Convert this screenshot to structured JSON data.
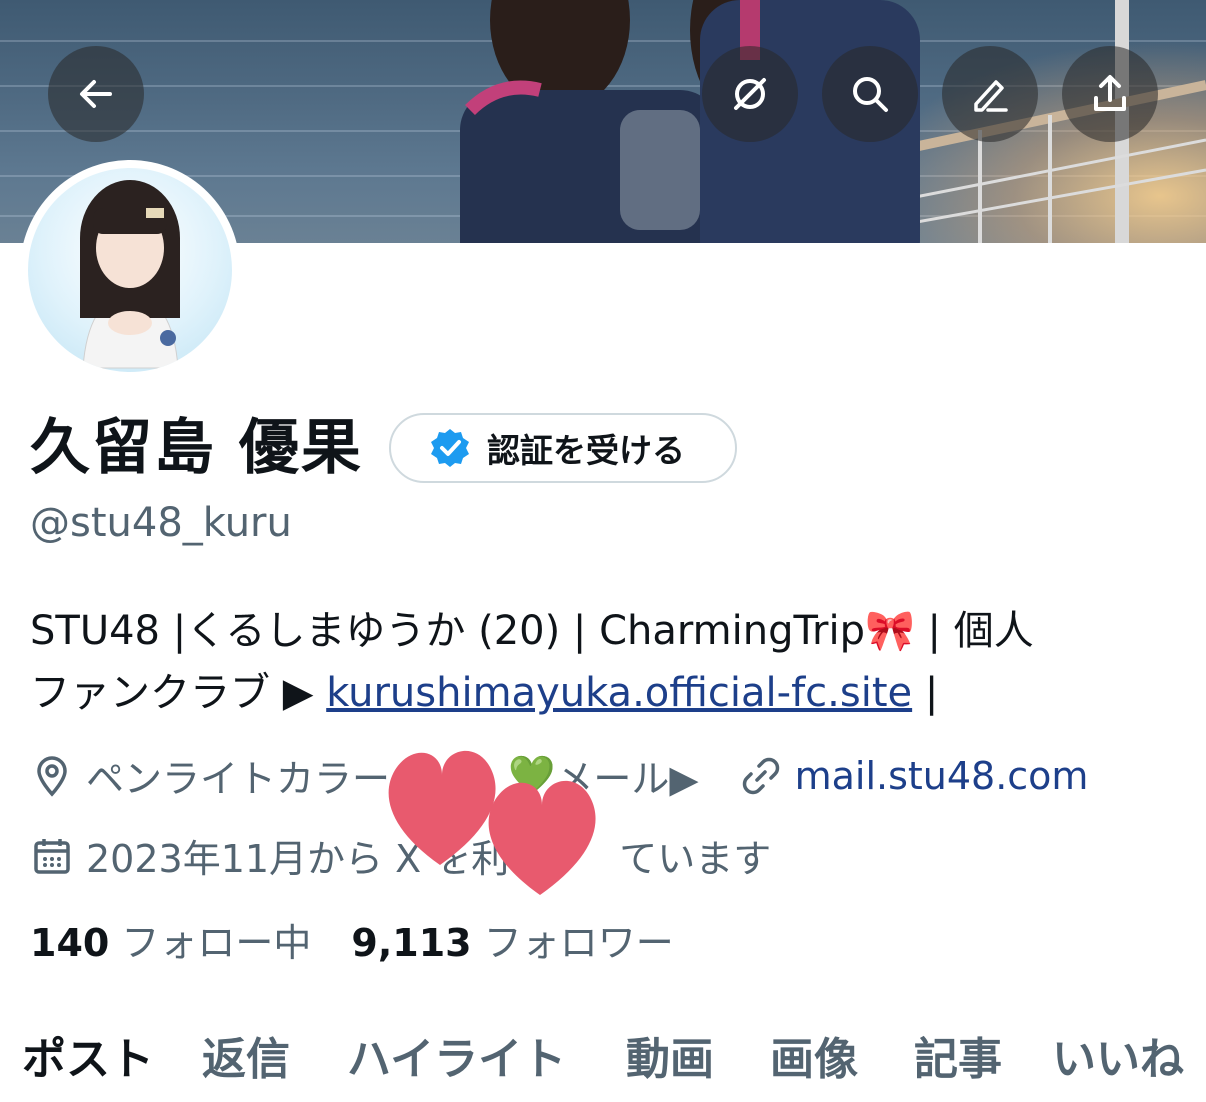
{
  "header": {
    "back_label": "back",
    "actions": [
      "grok-icon",
      "search-icon",
      "edit-icon",
      "share-icon"
    ]
  },
  "profile": {
    "display_name": "久留島 優果",
    "verify_button": "認証を受ける",
    "handle": "@stu48_kuru",
    "bio_line1": "STU48 |くるしまゆうか (20) | CharmingTrip🎀 |  個人",
    "bio_line2_prefix": "ファンクラブ ▶︎ ",
    "bio_link": "kurushimayuka.official-fc.site",
    "bio_line2_suffix": " |",
    "location_prefix": "ペンライトカラー",
    "location_emoji": "💚",
    "location_suffix": " メール▶︎",
    "website": "mail.stu48.com",
    "joined_prefix": "2023年11月から X を利",
    "joined_suffix": "ています",
    "following_count": "140",
    "following_label": " フォロー中",
    "followers_count": "9,113",
    "followers_label": " フォロワー"
  },
  "tabs": [
    "ポスト",
    "返信",
    "ハイライト",
    "動画",
    "画像",
    "記事",
    "いいね"
  ],
  "colors": {
    "text_primary": "#0f1419",
    "text_secondary": "#536471",
    "link": "#1d3f8a",
    "verified": "#1d9bf0",
    "heart": "#e85a6e"
  }
}
